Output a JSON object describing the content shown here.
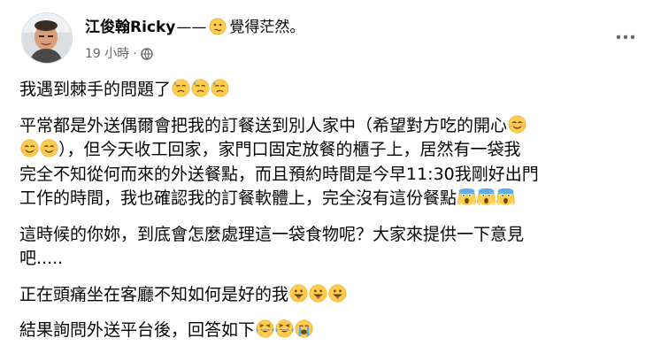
{
  "post": {
    "author": "江俊翰Ricky",
    "author_dash": "——",
    "feeling": "覺得茫然。",
    "feeling_icon": "confused-face-icon",
    "timestamp": "19 小時",
    "separator": "·",
    "privacy_icon": "public-globe-icon",
    "more_icon": "more-options-icon",
    "paragraphs": [
      {
        "text": "我遇到棘手的問題了",
        "emojis": [
          "sweat-face",
          "sweat-face",
          "sweat-face"
        ]
      },
      {
        "lines": [
          {
            "pre_emoji": [],
            "text": "平常都是外送偶爾會把我的訂餐送到別人家中（希望對方吃的開心",
            "post_emoji": [
              "smiling-face"
            ]
          },
          {
            "pre_emoji": [
              "smiling-face",
              "smiling-face"
            ],
            "text": "），但今天收工回家，家門口固定放餐的櫃子上，居然有一袋我",
            "post_emoji": []
          },
          {
            "pre_emoji": [],
            "text": "完全不知從何而來的外送餐點，而且預約時間是今早11:30我剛好出門",
            "post_emoji": []
          },
          {
            "pre_emoji": [],
            "text": "工作的時間，我也確認我的訂餐軟體上，完全沒有這份餐點",
            "post_emoji": [
              "screaming-face",
              "screaming-face",
              "screaming-face"
            ]
          }
        ]
      },
      {
        "lines": [
          {
            "pre_emoji": [],
            "text": "這時候的你妳，到底會怎麼處理這一袋食物呢？大家來提供一下意見",
            "post_emoji": []
          },
          {
            "pre_emoji": [],
            "text": "吧.....",
            "post_emoji": []
          }
        ]
      },
      {
        "text": "正在頭痛坐在客廳不知如何是好的我",
        "emojis": [
          "grinning-tongue-face",
          "grinning-tongue-face",
          "grinning-tongue-face"
        ]
      },
      {
        "text": "結果詢問外送平台後，回答如下",
        "emojis": [
          "laughing-tears-face",
          "laughing-tears-face",
          "crying-face"
        ]
      }
    ]
  },
  "colors": {
    "text": "#050505",
    "meta": "#65676b",
    "emoji_yellow": "#ffcc4d",
    "emoji_blue": "#5dadec"
  }
}
